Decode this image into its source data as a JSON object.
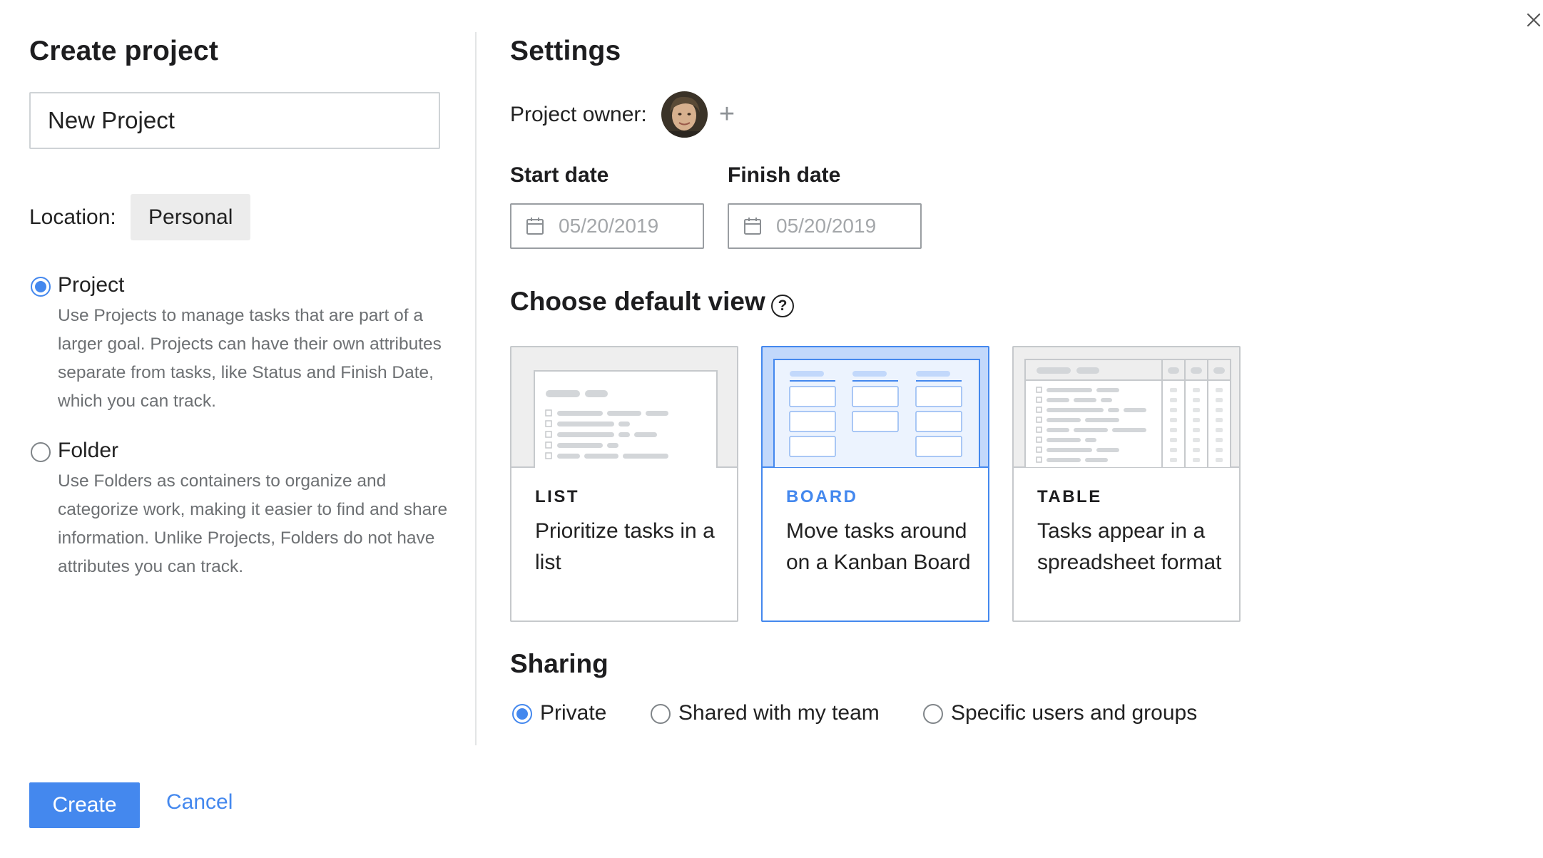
{
  "left": {
    "title": "Create project",
    "name_value": "New Project",
    "location_label": "Location:",
    "location_value": "Personal",
    "options": [
      {
        "label": "Project",
        "checked": true,
        "description": "Use Projects to manage tasks that are part of a larger goal. Projects can have their own attributes separate from tasks, like Status and Finish Date, which you can track."
      },
      {
        "label": "Folder",
        "checked": false,
        "description": "Use Folders as containers to organize and categorize work, making it easier to find and share information. Unlike Projects, Folders do not have attributes you can track."
      }
    ]
  },
  "settings": {
    "title": "Settings",
    "owner_label": "Project owner:",
    "add_owner_glyph": "+",
    "start_label": "Start date",
    "start_value": "05/20/2019",
    "finish_label": "Finish date",
    "finish_value": "05/20/2019"
  },
  "view": {
    "title": "Choose default view",
    "help_glyph": "?",
    "cards": [
      {
        "kind": "LIST",
        "desc": "Prioritize tasks in a list",
        "selected": false
      },
      {
        "kind": "BOARD",
        "desc": "Move tasks around on a Kanban Board",
        "selected": true
      },
      {
        "kind": "TABLE",
        "desc": "Tasks appear in a spreadsheet format",
        "selected": false
      }
    ]
  },
  "sharing": {
    "title": "Sharing",
    "options": [
      {
        "label": "Private",
        "checked": true
      },
      {
        "label": "Shared with my team",
        "checked": false
      },
      {
        "label": "Specific users and groups",
        "checked": false
      }
    ]
  },
  "actions": {
    "create_label": "Create",
    "cancel_label": "Cancel"
  },
  "colors": {
    "accent": "#4488ee",
    "selected_preview": "#c2d8fb",
    "muted_text": "#6d7073",
    "border": "#c6c9cc"
  }
}
